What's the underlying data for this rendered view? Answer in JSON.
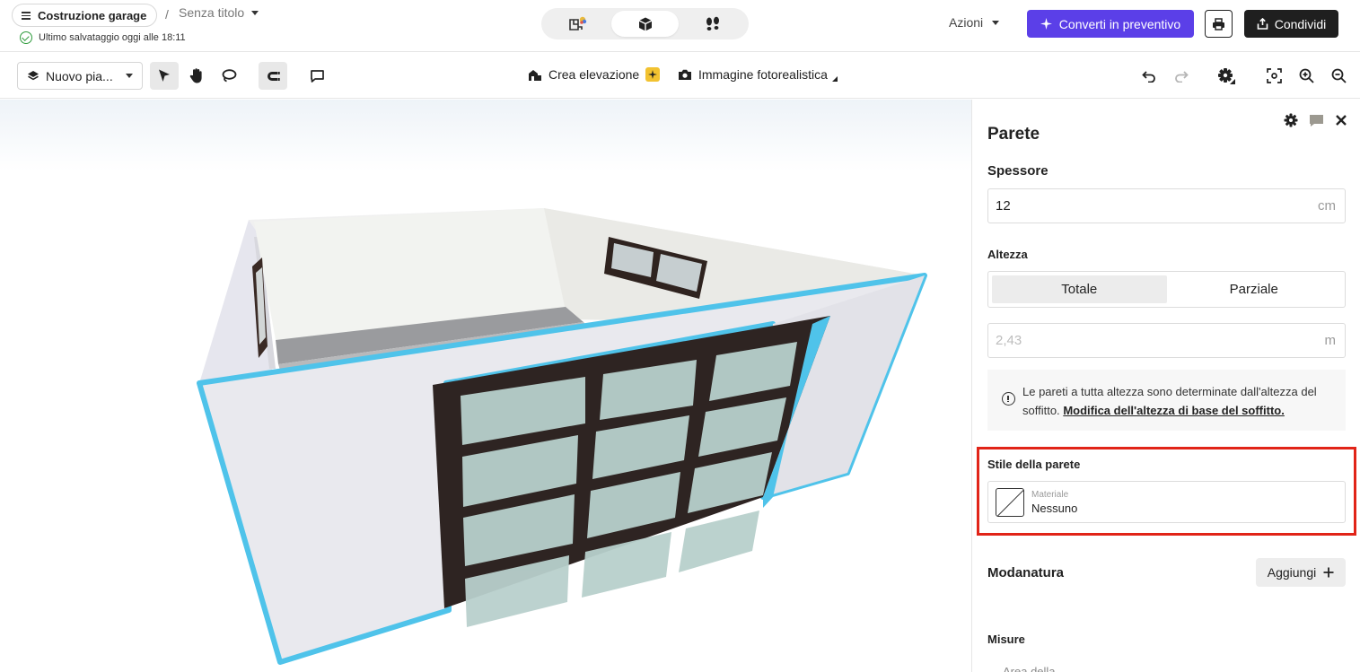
{
  "header": {
    "project_name": "Costruzione garage",
    "separator": "/",
    "document_title": "Senza titolo",
    "save_status": "Ultimo salvataggio oggi alle 18:11",
    "view_modes": [
      "2D plan",
      "3D view",
      "Walkthrough"
    ],
    "active_view": "3D view",
    "actions_label": "Azioni",
    "convert_label": "Converti in preventivo",
    "share_label": "Condividi",
    "accent_color": "#5b3fe8"
  },
  "toolbar": {
    "floor_select": "Nuovo pia...",
    "tools": [
      "select-tool",
      "pan-tool",
      "lasso-tool",
      "magnet-snap-tool",
      "comment-tool"
    ],
    "active_tools": [
      "select-tool",
      "magnet-snap-tool"
    ],
    "create_elevation": "Crea elevazione",
    "photoreal_image": "Immagine fotorealistica"
  },
  "panel": {
    "title": "Parete",
    "thickness_label": "Spessore",
    "thickness_value": "12",
    "thickness_unit": "cm",
    "height_label": "Altezza",
    "height_options": [
      "Totale",
      "Parziale"
    ],
    "height_selected": "Totale",
    "height_value": "2,43",
    "height_unit": "m",
    "info_text": "Le pareti a tutta altezza sono determinate dall'altezza del soffitto.",
    "info_link": "Modifica dell'altezza di base del soffitto.",
    "wall_style_label": "Stile della parete",
    "material_caption": "Materiale",
    "material_value": "Nessuno",
    "molding_label": "Modanatura",
    "add_label": "Aggiungi",
    "measures_label": "Misure",
    "cut_off_text": "Area della",
    "highlight_color": "#e12418",
    "selection_color": "#4fc3ea"
  }
}
